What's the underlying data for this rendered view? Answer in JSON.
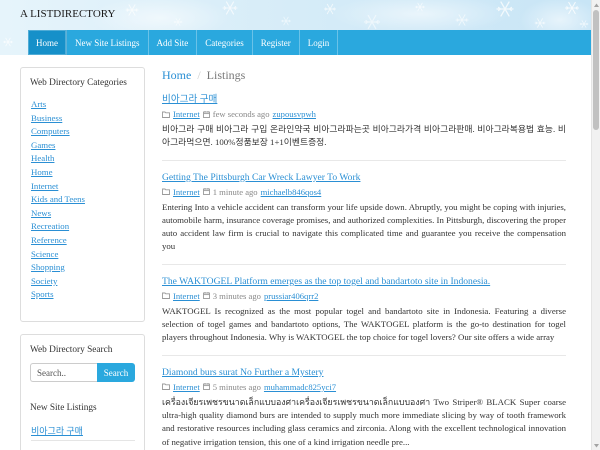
{
  "site": {
    "title": "A LISTDIRECTORY"
  },
  "nav": {
    "items": [
      {
        "label": "Home",
        "active": true
      },
      {
        "label": "New Site Listings",
        "active": false
      },
      {
        "label": "Add Site",
        "active": false
      },
      {
        "label": "Categories",
        "active": false
      },
      {
        "label": "Register",
        "active": false
      },
      {
        "label": "Login",
        "active": false
      }
    ]
  },
  "sidebar": {
    "categories": {
      "title": "Web Directory Categories",
      "items": [
        "Arts",
        "Business",
        "Computers",
        "Games",
        "Health",
        "Home",
        "Internet",
        "Kids and Teens",
        "News",
        "Recreation",
        "Reference",
        "Science",
        "Shopping",
        "Society",
        "Sports"
      ]
    },
    "search": {
      "title": "Web Directory Search",
      "placeholder": "Search..",
      "button_label": "Search"
    },
    "new_listings": {
      "title": "New Site Listings",
      "items": [
        "비아그라 구매"
      ]
    }
  },
  "breadcrumb": {
    "home": "Home",
    "separator": "/",
    "current": "Listings"
  },
  "listings": [
    {
      "title": "비아그라 구매",
      "category": "Internet",
      "time": "few seconds ago",
      "user": "zupousvpwh",
      "description": "비아그라 구매 비아그라 구입 온라인약국 비아그라파는곳 비아그라가격 비아그라판매. 비아그라복용법 효능. 비아그라먹으면. 100%정품보장 1+1이벤트증정."
    },
    {
      "title": "Getting The Pittsburgh Car Wreck Lawyer To Work",
      "category": "Internet",
      "time": "1 minute ago",
      "user": "michaelb846qos4",
      "description": "Entering Into a vehicle accident can transform your life upside down. Abruptly, you might be coping with injuries, automobile harm, insurance coverage promises, and authorized complexities. In Pittsburgh, discovering the proper auto accident law firm is crucial to navigate this complicated time and guarantee you receive the compensation you"
    },
    {
      "title": "The WAKTOGEL Platform emerges as the top togel and bandartoto site in Indonesia.",
      "category": "Internet",
      "time": "3 minutes ago",
      "user": "prussiar406qrr2",
      "description": "WAKTOGEL Is recognized as the most popular togel and bandartoto site in Indonesia. Featuring a diverse selection of togel games and bandartoto options, The WAKTOGEL platform is the go-to destination for togel players throughout Indonesia. Why is WAKTOGEL the top choice for togel lovers? Our site offers a wide array"
    },
    {
      "title": "Diamond burs surat No Further a Mystery",
      "category": "Internet",
      "time": "5 minutes ago",
      "user": "muhammadc825yci7",
      "description": "เครื่องเจียรเพชรขนาดเล็กแบบองศาเครื่องเจียรเพชรขนาดเล็กแบบองศา Two Striper® BLACK Super coarse ultra-high quality diamond burs are intended to supply much more immediate slicing by way of tooth framework and restorative resources including glass ceramics and zirconia. Along with the excellent technological innovation of negative irrigation tension, this one of a kind irrigation needle pre..."
    }
  ],
  "icons": {
    "category": "folder-icon",
    "date": "calendar-icon",
    "header": "snowflake-decoration"
  },
  "colors": {
    "nav": "#2aa8de",
    "nav_active": "#1690c9",
    "link": "#2a8fd4",
    "text": "#333333",
    "muted": "#888888",
    "header": "#d6ecf8"
  }
}
